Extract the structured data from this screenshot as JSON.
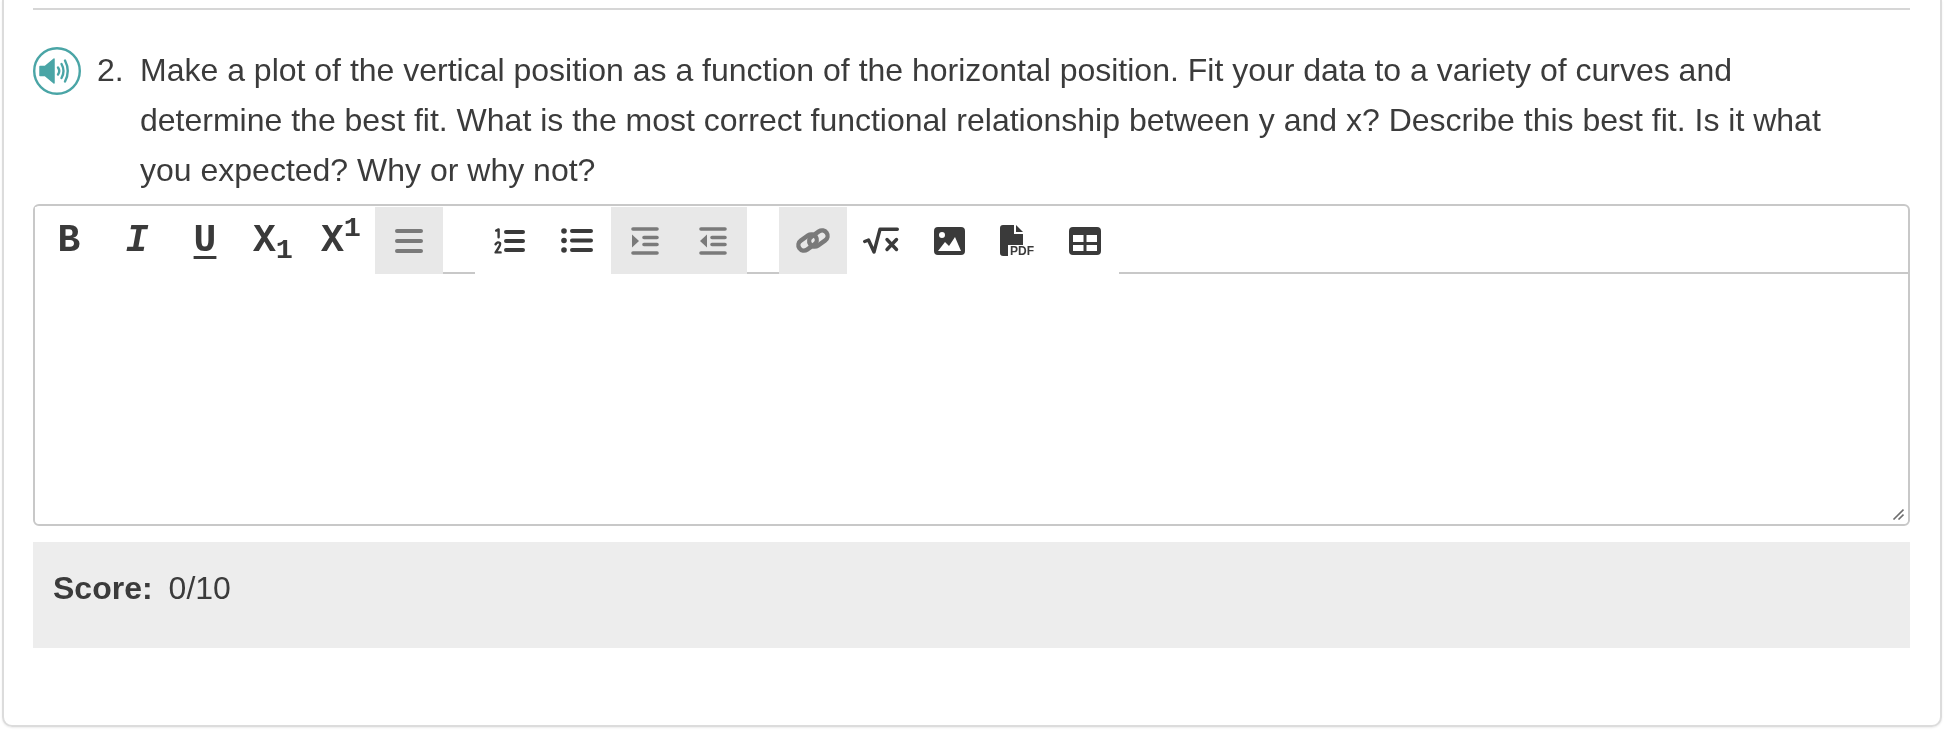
{
  "question": {
    "number": "2.",
    "text": "Make a plot of the vertical position as a function of the horizontal position. Fit your data to a variety of curves and determine the best fit. What is the most correct functional relationship between y and x? Describe this best fit. Is it what you expected? Why or why not?"
  },
  "toolbar": [
    {
      "items": [
        {
          "kind": "bold",
          "label": "B",
          "disabled": false
        },
        {
          "kind": "italic",
          "label": "I",
          "disabled": false
        },
        {
          "kind": "underline",
          "label": "U",
          "disabled": false
        },
        {
          "kind": "subscript",
          "label": "X$_{1}$",
          "disabled": false
        },
        {
          "kind": "superscript",
          "label": "X$^{1}$",
          "disabled": false
        },
        {
          "kind": "align",
          "disabled": true
        }
      ]
    },
    {
      "items": [
        {
          "kind": "ordered-list",
          "disabled": false
        },
        {
          "kind": "bullet-list",
          "disabled": false
        },
        {
          "kind": "indent",
          "disabled": true
        },
        {
          "kind": "outdent",
          "disabled": true
        }
      ]
    },
    {
      "items": [
        {
          "kind": "link",
          "disabled": true
        },
        {
          "kind": "equation",
          "disabled": false
        },
        {
          "kind": "image",
          "disabled": false
        },
        {
          "kind": "pdf",
          "label": "PDF",
          "disabled": false
        },
        {
          "kind": "table",
          "disabled": false
        }
      ]
    }
  ],
  "score": {
    "label": "Score:",
    "value": "0/10"
  }
}
